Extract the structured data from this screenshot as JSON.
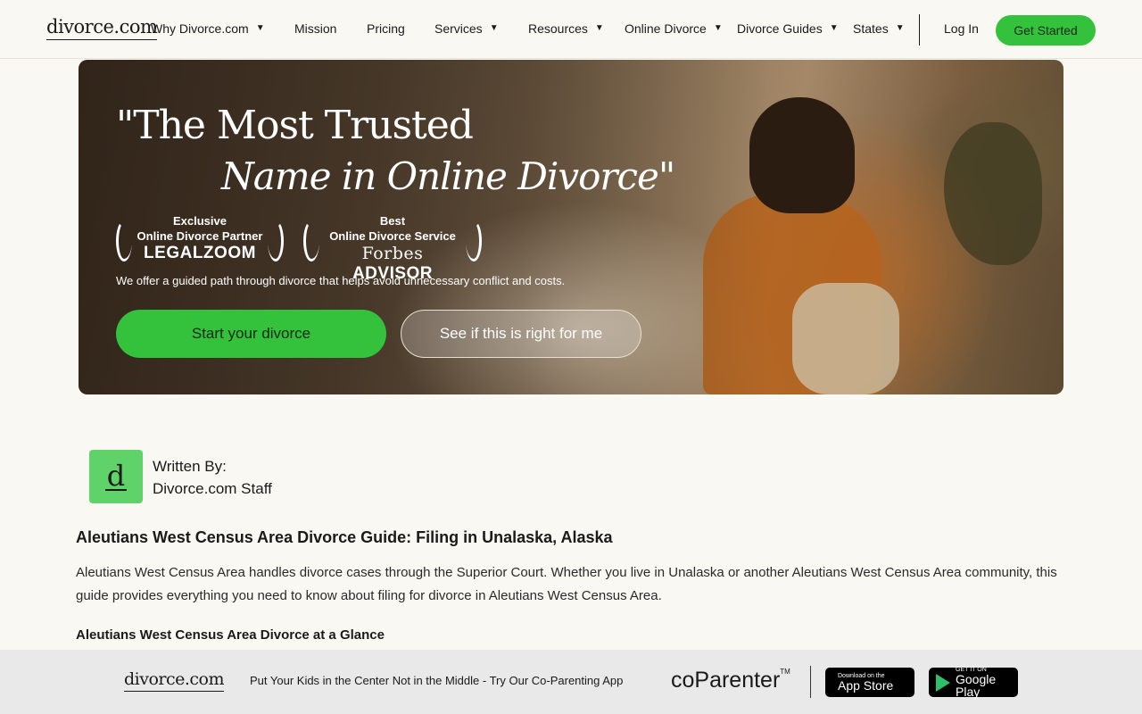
{
  "nav": {
    "logo": "divorce.com",
    "items": [
      {
        "label": "Why Divorce.com",
        "dropdown": true
      },
      {
        "label": "Mission",
        "dropdown": false
      },
      {
        "label": "Pricing",
        "dropdown": false
      },
      {
        "label": "Services",
        "dropdown": true
      },
      {
        "label": "Resources",
        "dropdown": true
      },
      {
        "label": "Online Divorce",
        "dropdown": true
      },
      {
        "label": "Divorce Guides",
        "dropdown": true
      },
      {
        "label": "States",
        "dropdown": true
      }
    ],
    "login": "Log In",
    "cta": "Get Started"
  },
  "hero": {
    "title_line1": "\"The Most Trusted",
    "title_line2": "Name in Online Divorce\"",
    "award1": {
      "line1": "Exclusive",
      "line2": "Online Divorce Partner",
      "brand": "LEGALZOOM"
    },
    "award2": {
      "line1": "Best",
      "line2": "Online Divorce Service",
      "brand_a": "Forbes",
      "brand_b": "ADVISOR"
    },
    "subtitle": "We offer a guided path through divorce that helps avoid unnecessary conflict and costs.",
    "primary_button": "Start your divorce",
    "secondary_button": "See if this is right for me"
  },
  "author": {
    "avatar_letter": "d",
    "label": "Written By:",
    "name": "Divorce.com Staff"
  },
  "article": {
    "title": "Aleutians West Census Area Divorce Guide: Filing in Unalaska, Alaska",
    "body": "Aleutians West Census Area handles divorce cases through the Superior Court. Whether you live in Unalaska or another Aleutians West Census Area community, this guide provides everything you need to know about filing for divorce in Aleutians West Census Area.",
    "section_heading": "Aleutians West Census Area Divorce at a Glance"
  },
  "footer_banner": {
    "logo": "divorce.com",
    "promo": "Put Your Kids in the Center Not in the Middle - Try Our Co-Parenting App",
    "app_name": "coParenter",
    "app_store": {
      "top": "Download on the",
      "main": "App Store"
    },
    "google_play": {
      "top": "GET IT ON",
      "main": "Google Play"
    }
  },
  "colors": {
    "accent_green": "#34c13b",
    "avatar_green": "#5fd36a",
    "background": "#faf8f3"
  }
}
